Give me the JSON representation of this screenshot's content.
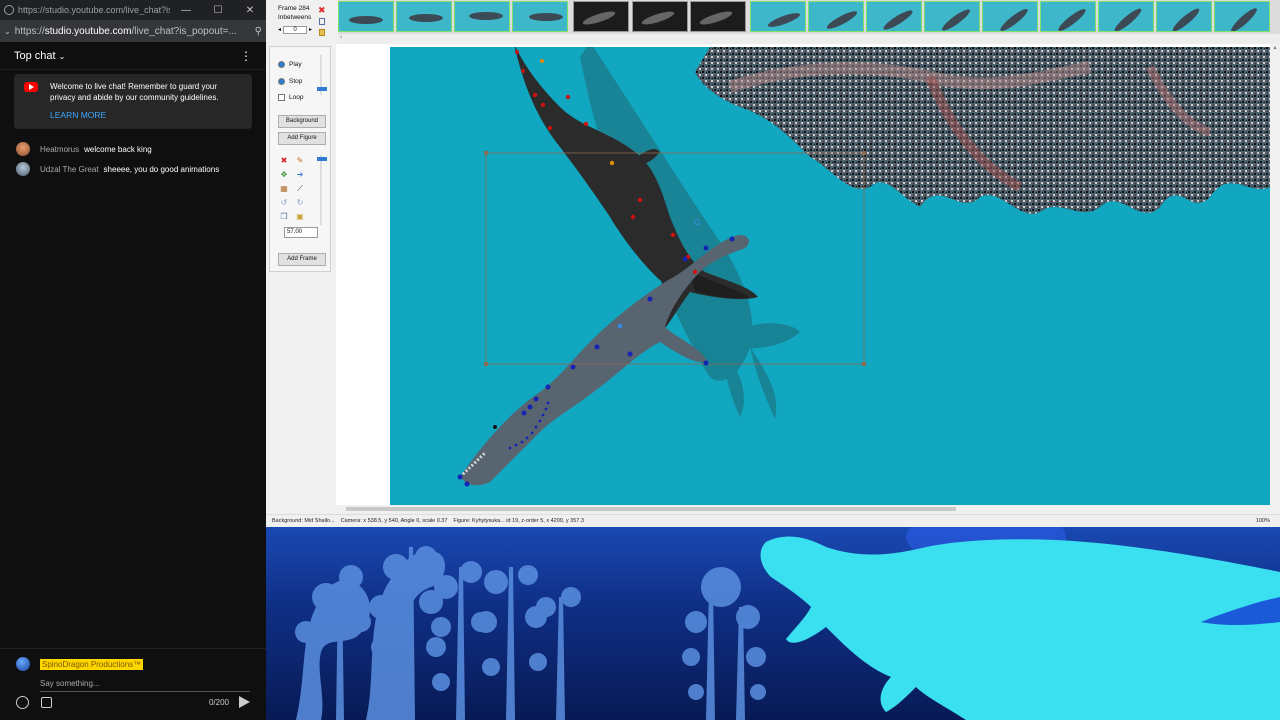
{
  "browser": {
    "tab_title": "https://studio.youtube.com/live_chat?is_...",
    "url_prefix": "https://",
    "url_host": "studio.youtube.com",
    "url_path": "/live_chat?is_popout=...",
    "minimize": "—",
    "maximize": "☐",
    "close": "✕"
  },
  "chat": {
    "header": "Top chat",
    "notice_text": "Welcome to live chat! Remember to guard your privacy and abide by our community guidelines.",
    "learn_more": "LEARN MORE",
    "messages": [
      {
        "author": "Heatmorus",
        "text": "welcome back king"
      },
      {
        "author": "Udzal The Great",
        "text": "sheeee, you do good animations"
      }
    ],
    "current_user": "SpinoDragon Productions™",
    "input_placeholder": "Say something...",
    "char_count": "0/200"
  },
  "editor": {
    "frame_label": "Frame 284",
    "inbetweens_label": "Inbetweens",
    "inbetweens_value": "0",
    "play": "Play",
    "stop": "Stop",
    "loop": "Loop",
    "background_btn": "Background",
    "add_figure_btn": "Add Figure",
    "add_frame_btn": "Add Frame",
    "scale_value": "57.00",
    "status_background": "Background: Mid Shallo...",
    "status_camera": "Camera: x 538.5, y 540, Angle 0, scale 0.37",
    "status_figure": "Figure: Kyhytysuka... id 19, z-order 5, x 4209, y 357.3",
    "zoom": "100%"
  },
  "colors": {
    "stage": "#11a7c0",
    "accent": "#2d7dd2",
    "chat_bg": "#0f0f0f"
  }
}
